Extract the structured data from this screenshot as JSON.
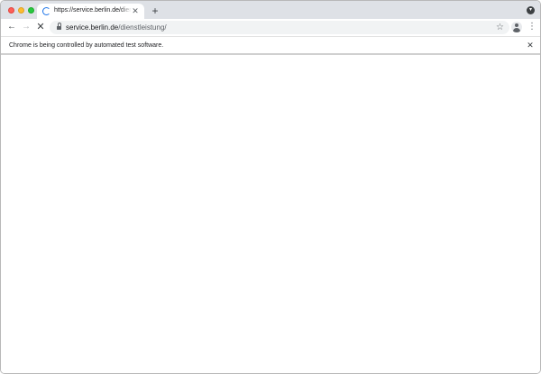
{
  "window": {
    "controls": [
      "close-window-button",
      "minimize-window-button",
      "maximize-window-button"
    ]
  },
  "tab": {
    "title": "https://service.berlin.de/dienstleistung/",
    "close_glyph": "✕",
    "loading": true
  },
  "new_tab_glyph": "+",
  "tab_search_glyph": "▾",
  "toolbar": {
    "back_glyph": "←",
    "forward_glyph": "→",
    "stop_glyph": "✕",
    "menu_glyph": "⋮"
  },
  "omnibox": {
    "host": "service.berlin.de",
    "path": "/dienstleistung/",
    "bookmark_glyph": "☆"
  },
  "infobar": {
    "message": "Chrome is being controlled by automated test software.",
    "close_glyph": "✕"
  },
  "icons": {
    "tab": "loading-spinner-icon",
    "omnibox": "lock-icon",
    "bookmark": "star-icon",
    "profile": "profile-icon"
  },
  "colors": {
    "tabstrip": "#dee1e6",
    "spinner": "#1a73e8",
    "close_light": "#ff5f57",
    "minimize_light": "#febc2e",
    "maximize_light": "#28c840"
  }
}
